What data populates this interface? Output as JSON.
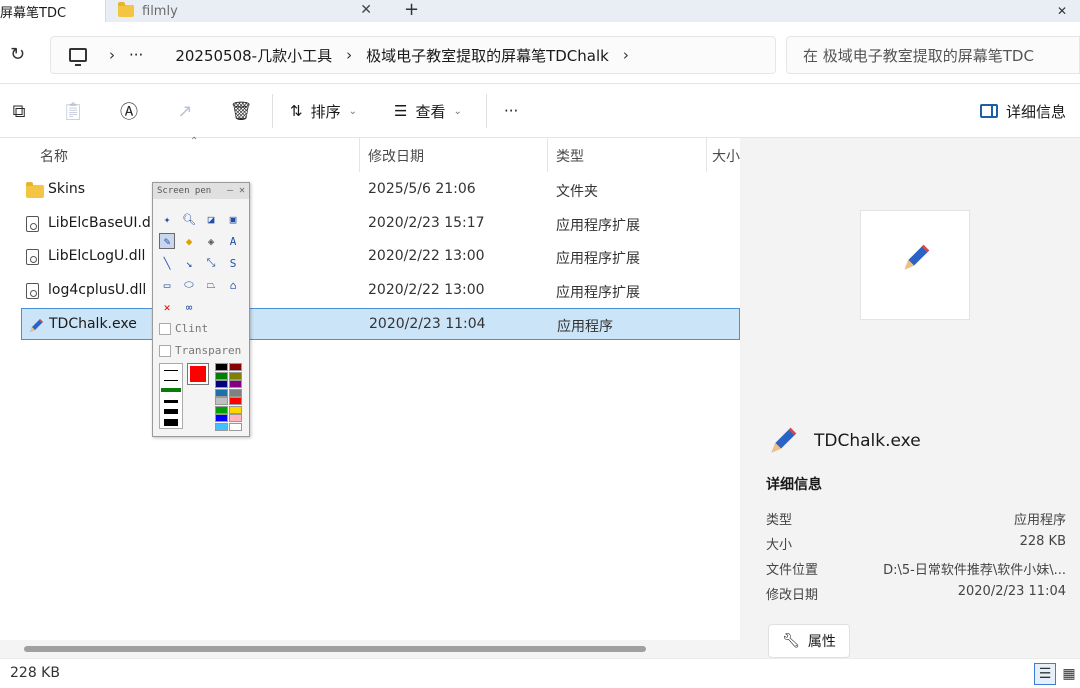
{
  "tabs": [
    {
      "label": "屏幕笔TDC",
      "close": "✕"
    },
    {
      "label": "filmly",
      "close": "✕"
    }
  ],
  "new_tab": "+",
  "window_close": "✕",
  "address": {
    "crumbs": [
      "20250508-几款小工具",
      "极域电子教室提取的屏幕笔TDChalk"
    ],
    "ellipsis": "···",
    "search_placeholder": "在 极域电子教室提取的屏幕笔TDC"
  },
  "toolbar": {
    "sort_label": "排序",
    "view_label": "查看",
    "more": "···",
    "details_label": "详细信息"
  },
  "columns": {
    "name": "名称",
    "date": "修改日期",
    "type": "类型",
    "size": "大小"
  },
  "files": [
    {
      "name": "Skins",
      "date": "2025/5/6 21:06",
      "type": "文件夹",
      "icon": "folder-icon"
    },
    {
      "name": "LibElcBaseUI.dll",
      "date": "2020/2/23 15:17",
      "type": "应用程序扩展",
      "icon": "dll-icon"
    },
    {
      "name": "LibElcLogU.dll",
      "date": "2020/2/22 13:00",
      "type": "应用程序扩展",
      "icon": "dll-icon"
    },
    {
      "name": "log4cplusU.dll",
      "date": "2020/2/22 13:00",
      "type": "应用程序扩展",
      "icon": "dll-icon"
    },
    {
      "name": "TDChalk.exe",
      "date": "2020/2/23 11:04",
      "type": "应用程序",
      "icon": "pen-icon"
    }
  ],
  "status": {
    "size": "228 KB"
  },
  "details": {
    "file_name": "TDChalk.exe",
    "section": "详细信息",
    "props": [
      {
        "key": "类型",
        "value": "应用程序"
      },
      {
        "key": "大小",
        "value": "228 KB"
      },
      {
        "key": "文件位置",
        "value": "D:\\5-日常软件推荐\\软件小妹\\..."
      },
      {
        "key": "修改日期",
        "value": "2020/2/23 11:04"
      }
    ],
    "properties_button": "属性"
  },
  "screen_pen": {
    "title": "Screen pen",
    "clint_label": "Clint",
    "transparent_label": "Transparen",
    "current_color": "#ff0000",
    "palette": [
      "#000000",
      "#8b0000",
      "#008000",
      "#808000",
      "#000080",
      "#800080",
      "#1f6fa8",
      "#808080",
      "#c0c0c0",
      "#ff0000",
      "#00a000",
      "#ffd700",
      "#0000ff",
      "#ffb6c1",
      "#40c0ff",
      "#ffffff"
    ]
  },
  "colors": {
    "accent": "#4a90d9",
    "selection": "#cce4f7"
  }
}
